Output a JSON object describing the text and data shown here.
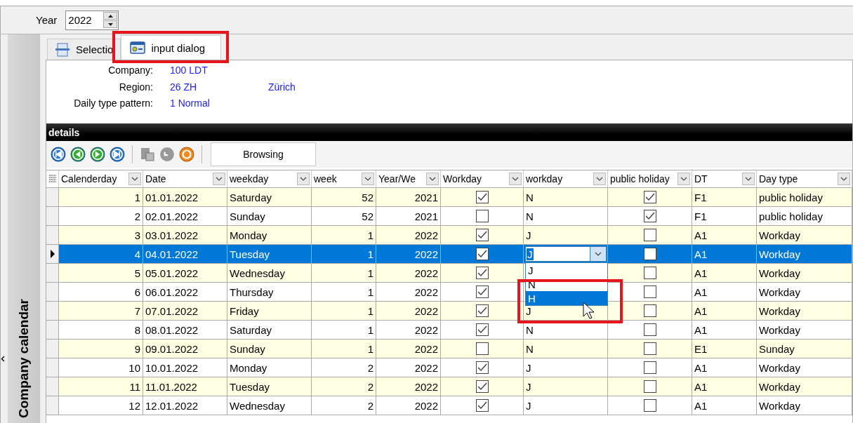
{
  "year": {
    "label": "Year",
    "value": "2022"
  },
  "sidebar": {
    "title": "Company calendar"
  },
  "tabs": [
    {
      "label": "Selectio",
      "selected": false,
      "kind": "list"
    },
    {
      "label": "input dialog",
      "selected": true,
      "kind": "dialog"
    }
  ],
  "info": [
    {
      "label": "Company:",
      "values": [
        "100 LDT"
      ]
    },
    {
      "label": "Region:",
      "values": [
        "26 ZH",
        "Zürich"
      ]
    },
    {
      "label": "Daily type pattern:",
      "values": [
        "1 Normal"
      ]
    }
  ],
  "details": {
    "title": "details",
    "status": "Browsing"
  },
  "table": {
    "columns": [
      {
        "label": "Calenderday",
        "kind": "num"
      },
      {
        "label": "Date",
        "kind": "text"
      },
      {
        "label": "weekday",
        "kind": "text"
      },
      {
        "label": "week",
        "kind": "num"
      },
      {
        "label": "Year/We",
        "kind": "num"
      },
      {
        "label": "Workday",
        "kind": "check"
      },
      {
        "label": "workday",
        "kind": "code"
      },
      {
        "label": "public holiday",
        "kind": "check"
      },
      {
        "label": "DT",
        "kind": "text"
      },
      {
        "label": "Day type",
        "kind": "text"
      }
    ],
    "rows": [
      {
        "selected": false,
        "cells": [
          "1",
          "01.01.2022",
          "Saturday",
          "52",
          "2021",
          true,
          "N",
          true,
          "F1",
          "public holiday"
        ]
      },
      {
        "selected": false,
        "cells": [
          "2",
          "02.01.2022",
          "Sunday",
          "52",
          "2021",
          false,
          "N",
          true,
          "F1",
          "public holiday"
        ]
      },
      {
        "selected": false,
        "cells": [
          "3",
          "03.01.2022",
          "Monday",
          "1",
          "2022",
          true,
          "J",
          false,
          "A1",
          "Workday"
        ]
      },
      {
        "selected": true,
        "cells": [
          "4",
          "04.01.2022",
          "Tuesday",
          "1",
          "2022",
          true,
          "J",
          false,
          "A1",
          "Workday"
        ]
      },
      {
        "selected": false,
        "cells": [
          "5",
          "05.01.2022",
          "Wednesday",
          "1",
          "2022",
          true,
          null,
          false,
          "A1",
          "Workday"
        ]
      },
      {
        "selected": false,
        "cells": [
          "6",
          "06.01.2022",
          "Thursday",
          "1",
          "2022",
          true,
          null,
          false,
          "A1",
          "Workday"
        ]
      },
      {
        "selected": false,
        "cells": [
          "7",
          "07.01.2022",
          "Friday",
          "1",
          "2022",
          true,
          "J",
          false,
          "A1",
          "Workday"
        ]
      },
      {
        "selected": false,
        "cells": [
          "8",
          "08.01.2022",
          "Saturday",
          "1",
          "2022",
          true,
          "N",
          false,
          "A1",
          "Workday"
        ]
      },
      {
        "selected": false,
        "cells": [
          "9",
          "09.01.2022",
          "Sunday",
          "1",
          "2022",
          false,
          "N",
          false,
          "E1",
          "Sunday"
        ]
      },
      {
        "selected": false,
        "cells": [
          "10",
          "10.01.2022",
          "Monday",
          "2",
          "2022",
          true,
          "J",
          false,
          "A1",
          "Workday"
        ]
      },
      {
        "selected": false,
        "cells": [
          "11",
          "11.01.2022",
          "Tuesday",
          "2",
          "2022",
          true,
          "J",
          false,
          "A1",
          "Workday"
        ]
      },
      {
        "selected": false,
        "cells": [
          "12",
          "12.01.2022",
          "Wednesday",
          "2",
          "2022",
          true,
          "J",
          false,
          "A1",
          "Workday"
        ]
      }
    ]
  },
  "dropdown": {
    "options": [
      {
        "label": "J",
        "selected": false
      },
      {
        "label": "N",
        "selected": false
      },
      {
        "label": "H",
        "selected": true
      }
    ]
  }
}
